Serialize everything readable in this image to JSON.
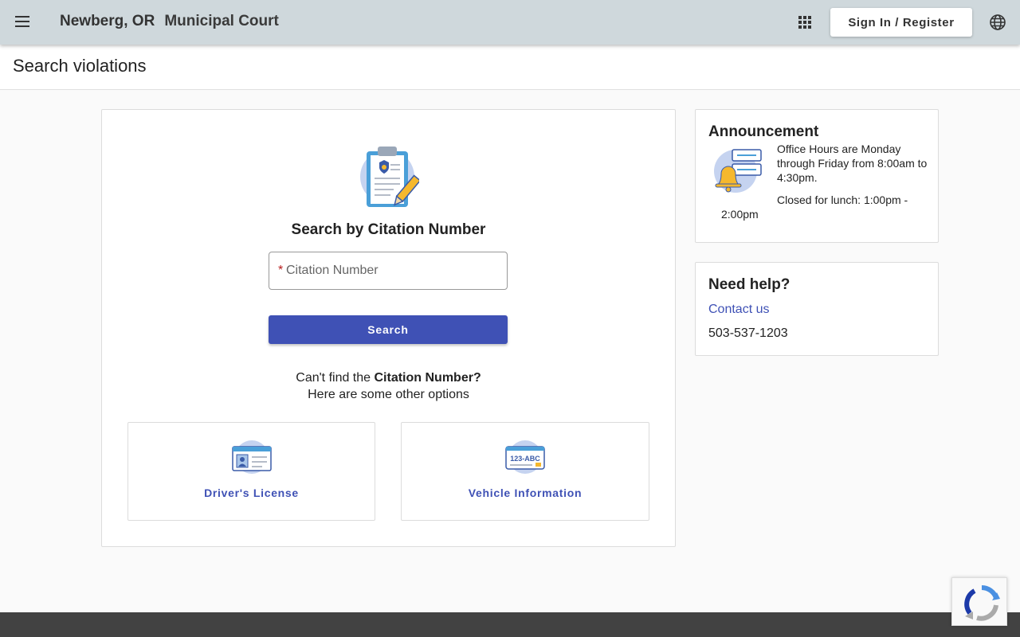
{
  "header": {
    "city": "Newberg, OR",
    "court": "Municipal Court",
    "signin_label": "Sign In / Register"
  },
  "page": {
    "title": "Search violations"
  },
  "search": {
    "title": "Search by Citation Number",
    "citation_placeholder": "Citation Number",
    "citation_value": "",
    "required_mark": "*",
    "button_label": "Search",
    "cant_find_prefix": "Can't find the",
    "cant_find_bold": "Citation Number?",
    "other_options": "Here are some other options"
  },
  "options": [
    {
      "label": "Driver's License",
      "icon": "drivers-license-icon"
    },
    {
      "label": "Vehicle Information",
      "icon": "license-plate-icon",
      "plate_text": "123-ABC"
    }
  ],
  "announcement": {
    "title": "Announcement",
    "line1": "Office Hours are Monday through Friday from 8:00am to 4:30pm.",
    "line2": "Closed for lunch: 1:00pm -",
    "line3": "2:00pm"
  },
  "help": {
    "title": "Need help?",
    "contact_label": "Contact us",
    "phone": "503-537-1203"
  },
  "colors": {
    "topbar": "#cfd8dc",
    "primary": "#3f51b5",
    "footer": "#424242"
  }
}
